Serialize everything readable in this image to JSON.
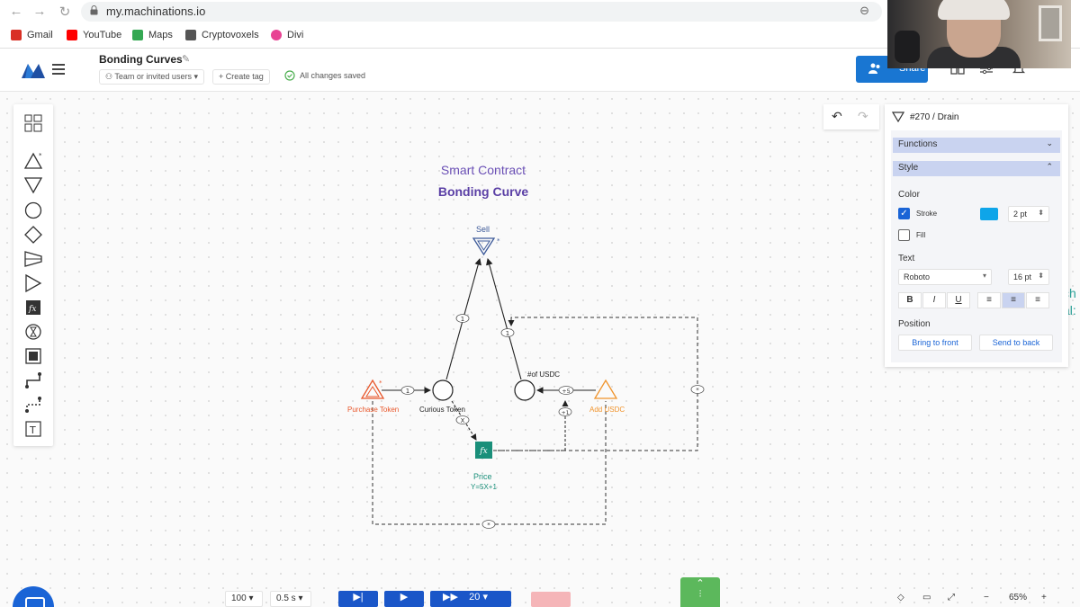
{
  "browser": {
    "url": "my.machinations.io",
    "bookmarks": [
      "Gmail",
      "YouTube",
      "Maps",
      "Cryptovoxels",
      "Divi"
    ]
  },
  "header": {
    "doc_title": "Bonding Curves",
    "team_label": "Team or invited users",
    "create_tag_label": "+ Create tag",
    "saved_status": "All changes saved",
    "share_label": "Share"
  },
  "diagram": {
    "title": "Smart Contract",
    "subtitle": "Bonding Curve",
    "nodes": {
      "sell": "Sell",
      "purchase_token": "Purchase Token",
      "curious_token": "Curious Token",
      "usdc_pool": "#of USDC",
      "add_usdc": "Add USDC",
      "price": "Price",
      "price_formula": "Y=5X+1"
    },
    "edge_labels": {
      "purchase_flow": "1",
      "sell_flow_left": "1",
      "sell_flow_right": "1",
      "to_price": "X",
      "add_flow": "+5",
      "price_state": "+1",
      "dashed_right": "*",
      "dashed_bottom": "*"
    },
    "offscreen_text": [
      "ch",
      "al:"
    ]
  },
  "panel": {
    "title": "#270 / Drain",
    "functions_label": "Functions",
    "style_label": "Style",
    "color_label": "Color",
    "stroke_label": "Stroke",
    "stroke_checked": true,
    "stroke_color": "#0ea5e9",
    "stroke_width": "2 pt",
    "fill_label": "Fill",
    "fill_checked": false,
    "text_label": "Text",
    "font": "Roboto",
    "font_size": "16 pt",
    "format_buttons": [
      "B",
      "I",
      "U"
    ],
    "position_label": "Position",
    "bring_front_label": "Bring to front",
    "send_back_label": "Send to back"
  },
  "bottom": {
    "steps_value": "100",
    "interval_value": "0.5 s",
    "runs_value": "20",
    "zoom_value": "65%"
  },
  "colors": {
    "accent": "#1976d2",
    "purple_title": "#6a4fb5",
    "source_red": "#e8562a",
    "source_orange": "#f0932b",
    "drain_blue": "#3d5a99",
    "register_teal": "#1a8f7a"
  }
}
